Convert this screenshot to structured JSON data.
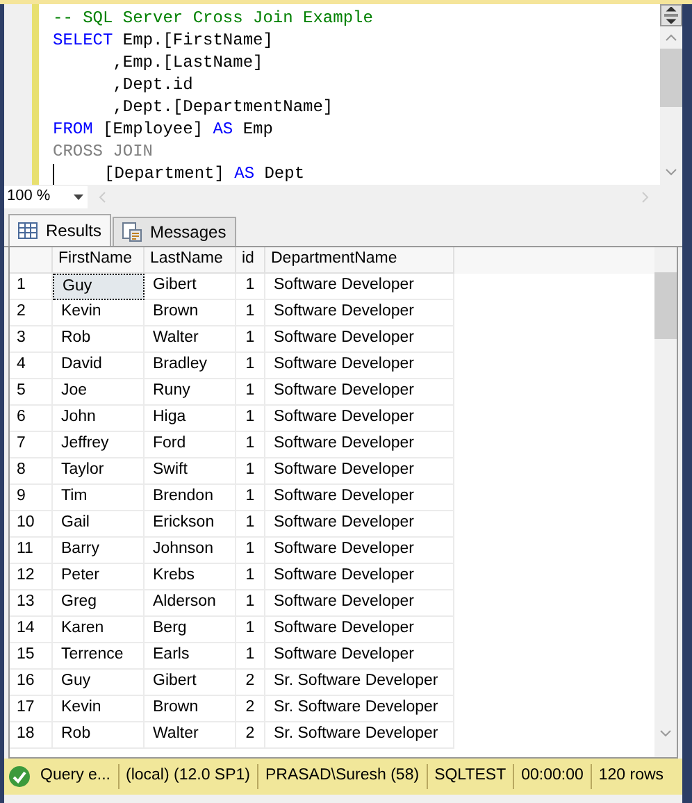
{
  "editor": {
    "lines": [
      {
        "caret": false,
        "tokens": [
          {
            "kind": "comment",
            "text": "-- SQL Server Cross Join Example"
          }
        ]
      },
      {
        "caret": false,
        "tokens": [
          {
            "kind": "keyword",
            "text": "SELECT"
          },
          {
            "kind": "plain",
            "text": " Emp.[FirstName]"
          }
        ]
      },
      {
        "caret": false,
        "tokens": [
          {
            "kind": "plain",
            "text": "      ,Emp.[LastName]"
          }
        ]
      },
      {
        "caret": false,
        "tokens": [
          {
            "kind": "plain",
            "text": "      ,Dept.id"
          }
        ]
      },
      {
        "caret": false,
        "tokens": [
          {
            "kind": "plain",
            "text": "      ,Dept.[DepartmentName]"
          }
        ]
      },
      {
        "caret": false,
        "tokens": [
          {
            "kind": "keyword",
            "text": "FROM"
          },
          {
            "kind": "plain",
            "text": " [Employee] "
          },
          {
            "kind": "keyword",
            "text": "AS"
          },
          {
            "kind": "plain",
            "text": " Emp"
          }
        ]
      },
      {
        "caret": false,
        "tokens": [
          {
            "kind": "operator",
            "text": "CROSS JOIN"
          }
        ]
      },
      {
        "caret": true,
        "tokens": [
          {
            "kind": "plain",
            "text": "     [Department] "
          },
          {
            "kind": "keyword",
            "text": "AS"
          },
          {
            "kind": "plain",
            "text": " Dept"
          }
        ]
      }
    ]
  },
  "zoom": {
    "value": "100 %"
  },
  "tabs": [
    {
      "label": "Results",
      "selected": true,
      "kind": "grid"
    },
    {
      "label": "Messages",
      "selected": false,
      "kind": "messages"
    }
  ],
  "table": {
    "columns": [
      "FirstName",
      "LastName",
      "id",
      "DepartmentName"
    ],
    "rows": [
      {
        "number": "1",
        "cells": [
          "Guy",
          "Gibert",
          "1",
          "Software Developer"
        ],
        "focused": true
      },
      {
        "number": "2",
        "cells": [
          "Kevin",
          "Brown",
          "1",
          "Software Developer"
        ],
        "focused": false
      },
      {
        "number": "3",
        "cells": [
          "Rob",
          "Walter",
          "1",
          "Software Developer"
        ],
        "focused": false
      },
      {
        "number": "4",
        "cells": [
          "David",
          "Bradley",
          "1",
          "Software Developer"
        ],
        "focused": false
      },
      {
        "number": "5",
        "cells": [
          "Joe",
          "Runy",
          "1",
          "Software Developer"
        ],
        "focused": false
      },
      {
        "number": "6",
        "cells": [
          "John",
          "Higa",
          "1",
          "Software Developer"
        ],
        "focused": false
      },
      {
        "number": "7",
        "cells": [
          "Jeffrey",
          "Ford",
          "1",
          "Software Developer"
        ],
        "focused": false
      },
      {
        "number": "8",
        "cells": [
          "Taylor",
          "Swift",
          "1",
          "Software Developer"
        ],
        "focused": false
      },
      {
        "number": "9",
        "cells": [
          "Tim",
          "Brendon",
          "1",
          "Software Developer"
        ],
        "focused": false
      },
      {
        "number": "10",
        "cells": [
          "Gail",
          "Erickson",
          "1",
          "Software Developer"
        ],
        "focused": false
      },
      {
        "number": "11",
        "cells": [
          "Barry",
          "Johnson",
          "1",
          "Software Developer"
        ],
        "focused": false
      },
      {
        "number": "12",
        "cells": [
          "Peter",
          "Krebs",
          "1",
          "Software Developer"
        ],
        "focused": false
      },
      {
        "number": "13",
        "cells": [
          "Greg",
          "Alderson",
          "1",
          "Software Developer"
        ],
        "focused": false
      },
      {
        "number": "14",
        "cells": [
          "Karen",
          "Berg",
          "1",
          "Software Developer"
        ],
        "focused": false
      },
      {
        "number": "15",
        "cells": [
          "Terrence",
          "Earls",
          "1",
          "Software Developer"
        ],
        "focused": false
      },
      {
        "number": "16",
        "cells": [
          "Guy",
          "Gibert",
          "2",
          "Sr. Software Developer"
        ],
        "focused": false
      },
      {
        "number": "17",
        "cells": [
          "Kevin",
          "Brown",
          "2",
          "Sr. Software Developer"
        ],
        "focused": false
      },
      {
        "number": "18",
        "cells": [
          "Rob",
          "Walter",
          "2",
          "Sr. Software Developer"
        ],
        "focused": false
      }
    ]
  },
  "status_bar": [
    "Query e...",
    "(local) (12.0 SP1)",
    "PRASAD\\Suresh (58)",
    "SQLTEST",
    "00:00:00",
    "120 rows"
  ]
}
